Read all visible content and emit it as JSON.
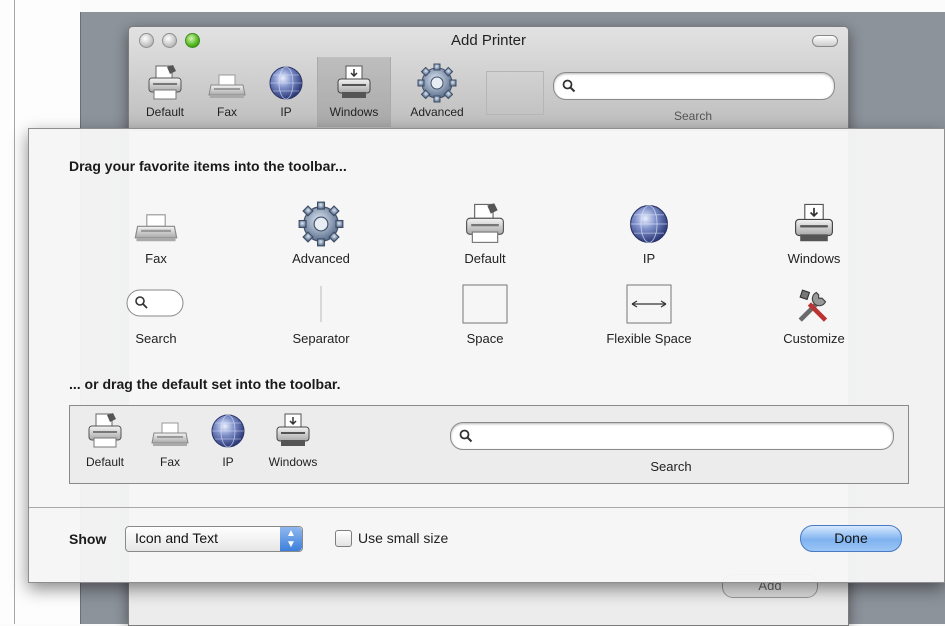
{
  "window": {
    "title": "Add Printer",
    "toolbar": [
      {
        "label": "Default",
        "icon": "default-printer-icon"
      },
      {
        "label": "Fax",
        "icon": "fax-icon"
      },
      {
        "label": "IP",
        "icon": "ip-globe-icon"
      },
      {
        "label": "Windows",
        "icon": "windows-printer-icon",
        "selected": true
      },
      {
        "label": "Advanced",
        "icon": "gear-icon"
      }
    ],
    "search_label": "Search",
    "add_label": "Add"
  },
  "sheet": {
    "heading_favorites": "Drag your favorite items into the toolbar...",
    "palette_row1": [
      {
        "label": "Fax",
        "icon": "fax-icon"
      },
      {
        "label": "Advanced",
        "icon": "gear-icon"
      },
      {
        "label": "Default",
        "icon": "default-printer-icon"
      },
      {
        "label": "IP",
        "icon": "ip-globe-icon"
      },
      {
        "label": "Windows",
        "icon": "windows-printer-icon"
      }
    ],
    "palette_row2": [
      {
        "label": "Search",
        "icon": "search-field-icon"
      },
      {
        "label": "Separator",
        "icon": "separator-icon"
      },
      {
        "label": "Space",
        "icon": "space-icon"
      },
      {
        "label": "Flexible Space",
        "icon": "flexible-space-icon"
      },
      {
        "label": "Customize",
        "icon": "tools-icon"
      }
    ],
    "heading_default": "... or drag the default set into the toolbar.",
    "default_set": [
      {
        "label": "Default",
        "icon": "default-printer-icon"
      },
      {
        "label": "Fax",
        "icon": "fax-icon"
      },
      {
        "label": "IP",
        "icon": "ip-globe-icon"
      },
      {
        "label": "Windows",
        "icon": "windows-printer-icon"
      }
    ],
    "default_search_label": "Search",
    "show_label": "Show",
    "show_value": "Icon and Text",
    "small_size_label": "Use small size",
    "small_size_checked": false,
    "done_label": "Done"
  },
  "colors": {
    "desktop": "#8d939b",
    "accent_blue": "#3c7fdb",
    "traffic_green": "#4fb61d"
  }
}
